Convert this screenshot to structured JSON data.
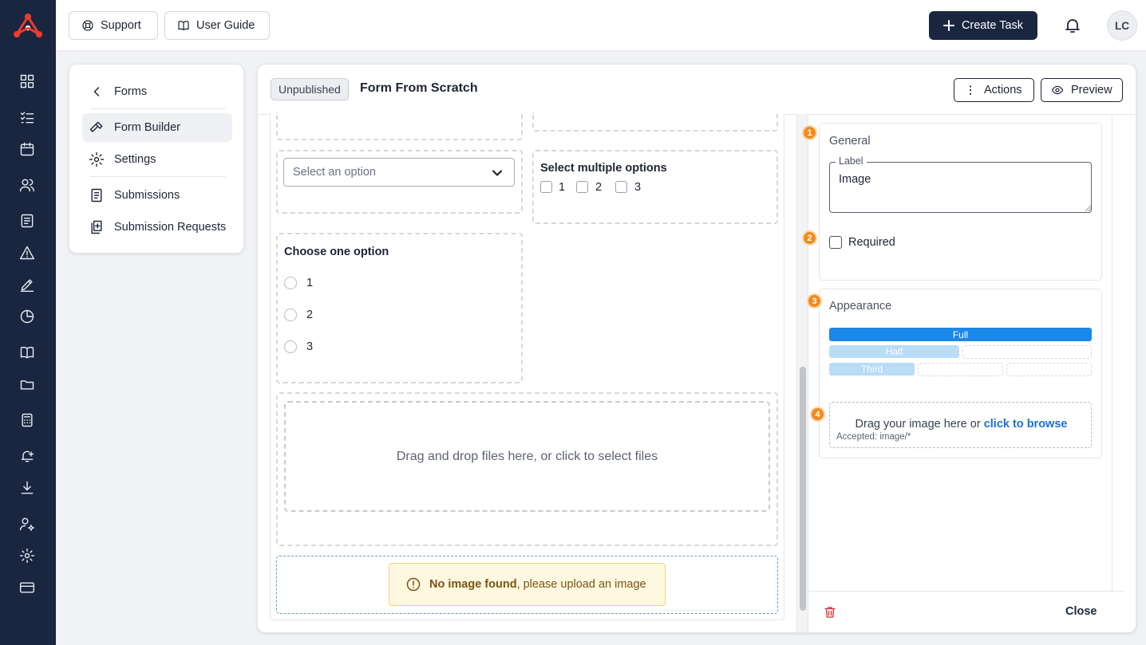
{
  "topbar": {
    "support_label": "Support",
    "guide_label": "User Guide",
    "create_task_label": "Create Task",
    "avatar_initials": "LC"
  },
  "sidenav": {
    "back_label": "Forms",
    "items": [
      {
        "label": "Form Builder",
        "icon": "hammer-icon",
        "active": true
      },
      {
        "label": "Settings",
        "icon": "gear-icon"
      },
      {
        "label": "Submissions",
        "icon": "document-icon"
      },
      {
        "label": "Submission Requests",
        "icon": "document-plus-icon"
      }
    ]
  },
  "header": {
    "status_badge": "Unpublished",
    "title": "Form From Scratch",
    "actions_label": "Actions",
    "preview_label": "Preview"
  },
  "canvas": {
    "select": {
      "placeholder": "Select an option"
    },
    "multi": {
      "label": "Select multiple options",
      "options": [
        "1",
        "2",
        "3"
      ]
    },
    "single": {
      "label": "Choose one option",
      "options": [
        "1",
        "2",
        "3"
      ]
    },
    "dropzone_text": "Drag and drop files here, or click to select files",
    "image_alert": {
      "bold": "No image found",
      "rest": ", please upload an image"
    }
  },
  "properties": {
    "general": {
      "step": "1",
      "title": "General",
      "label_legend": "Label",
      "label_value": "Image",
      "required_step": "2",
      "required_label": "Required",
      "required_checked": false
    },
    "appearance": {
      "step": "3",
      "title": "Appearance",
      "widths": [
        "Full",
        "Half",
        "Third"
      ],
      "selected_width": "Full"
    },
    "upload": {
      "step": "4",
      "text": "Drag your image here or ",
      "link": "click to browse",
      "accepted": "Accepted: image/*"
    },
    "close_label": "Close"
  },
  "colors": {
    "rail": "#1a2640",
    "accent": "#1c88e8",
    "step_badge": "#f28a1e",
    "alert_bg": "#fff8e1",
    "delete": "#d32f2f"
  }
}
